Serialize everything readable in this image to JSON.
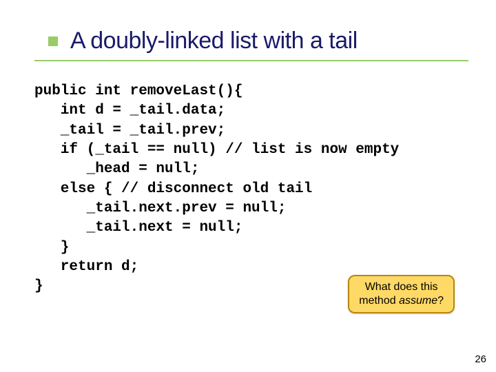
{
  "slide": {
    "title": "A doubly-linked list with a tail",
    "code": "public int removeLast(){\n   int d = _tail.data;\n   _tail = _tail.prev;\n   if (_tail == null) // list is now empty\n      _head = null;\n   else { // disconnect old tail\n      _tail.next.prev = null;\n      _tail.next = null;\n   }\n   return d;\n}",
    "callout_line1": "What does this",
    "callout_line2_prefix": "method ",
    "callout_line2_em": "assume",
    "callout_line2_suffix": "?",
    "page_number": "26"
  }
}
